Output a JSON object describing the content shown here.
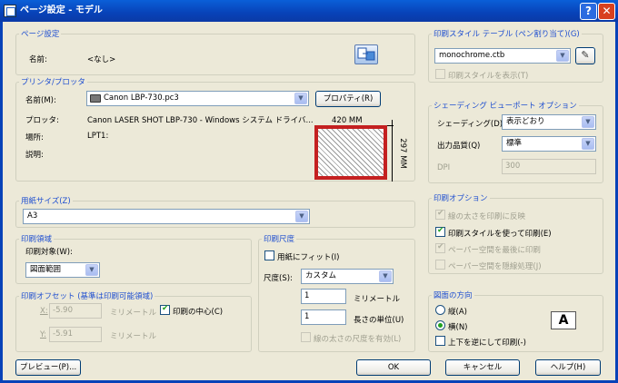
{
  "window": {
    "title": "ページ設定 - モデル",
    "help": "?",
    "close": "✕"
  },
  "page_setup": {
    "group_label": "ページ設定",
    "name_label": "名前:",
    "name_value": "<なし>"
  },
  "printer": {
    "group_label": "プリンタ/プロッタ",
    "name_label": "名前(M):",
    "name_value": "Canon LBP-730.pc3",
    "properties_button": "プロパティ(R)",
    "plotter_label": "プロッタ:",
    "plotter_value": "Canon LASER SHOT LBP-730 - Windows システム ドライバ...",
    "where_label": "場所:",
    "where_value": "LPT1:",
    "description_label": "説明:",
    "preview_width": "420 MM",
    "preview_height": "297 MM"
  },
  "paper_size": {
    "group_label": "用紙サイズ(Z)",
    "value": "A3"
  },
  "plot_area": {
    "group_label": "印刷領域",
    "what_label": "印刷対象(W):",
    "what_value": "図面範囲"
  },
  "plot_offset": {
    "group_label": "印刷オフセット (基準は印刷可能領域)",
    "x_label": "X:",
    "x_value": "-5.90",
    "x_unit": "ミリメートル",
    "y_label": "Y:",
    "y_value": "-5.91",
    "y_unit": "ミリメートル",
    "center_label": "印刷の中心(C)",
    "center_checked": true
  },
  "plot_scale": {
    "group_label": "印刷尺度",
    "fit_label": "用紙にフィット(I)",
    "fit_checked": false,
    "scale_label": "尺度(S):",
    "scale_value": "カスタム",
    "value1": "1",
    "unit1": "ミリメートル",
    "value2": "1",
    "unit2": "長さの単位(U)",
    "lineweights_label": "線の太さの尺度を有効(L)"
  },
  "plot_style_table": {
    "group_label": "印刷スタイル テーブル (ペン割り当て)(G)",
    "value": "monochrome.ctb",
    "display_label": "印刷スタイルを表示(T)"
  },
  "shaded_viewport": {
    "group_label": "シェーディング ビューポート オプション",
    "shade_label": "シェーディング(D)",
    "shade_value": "表示どおり",
    "quality_label": "出力品質(Q)",
    "quality_value": "標準",
    "dpi_label": "DPI",
    "dpi_value": "300"
  },
  "plot_options": {
    "group_label": "印刷オプション",
    "opt1": "線の太さを印刷に反映",
    "opt2": "印刷スタイルを使って印刷(E)",
    "opt3": "ペーパー空間を最後に印刷",
    "opt4": "ペーパー空間を隠線処理(J)"
  },
  "orientation": {
    "group_label": "図面の方向",
    "portrait": "縦(A)",
    "landscape": "横(N)",
    "upside_down": "上下を逆にして印刷(-)",
    "icon_letter": "A"
  },
  "buttons": {
    "preview": "プレビュー(P)...",
    "ok": "OK",
    "cancel": "キャンセル",
    "help": "ヘルプ(H)"
  }
}
